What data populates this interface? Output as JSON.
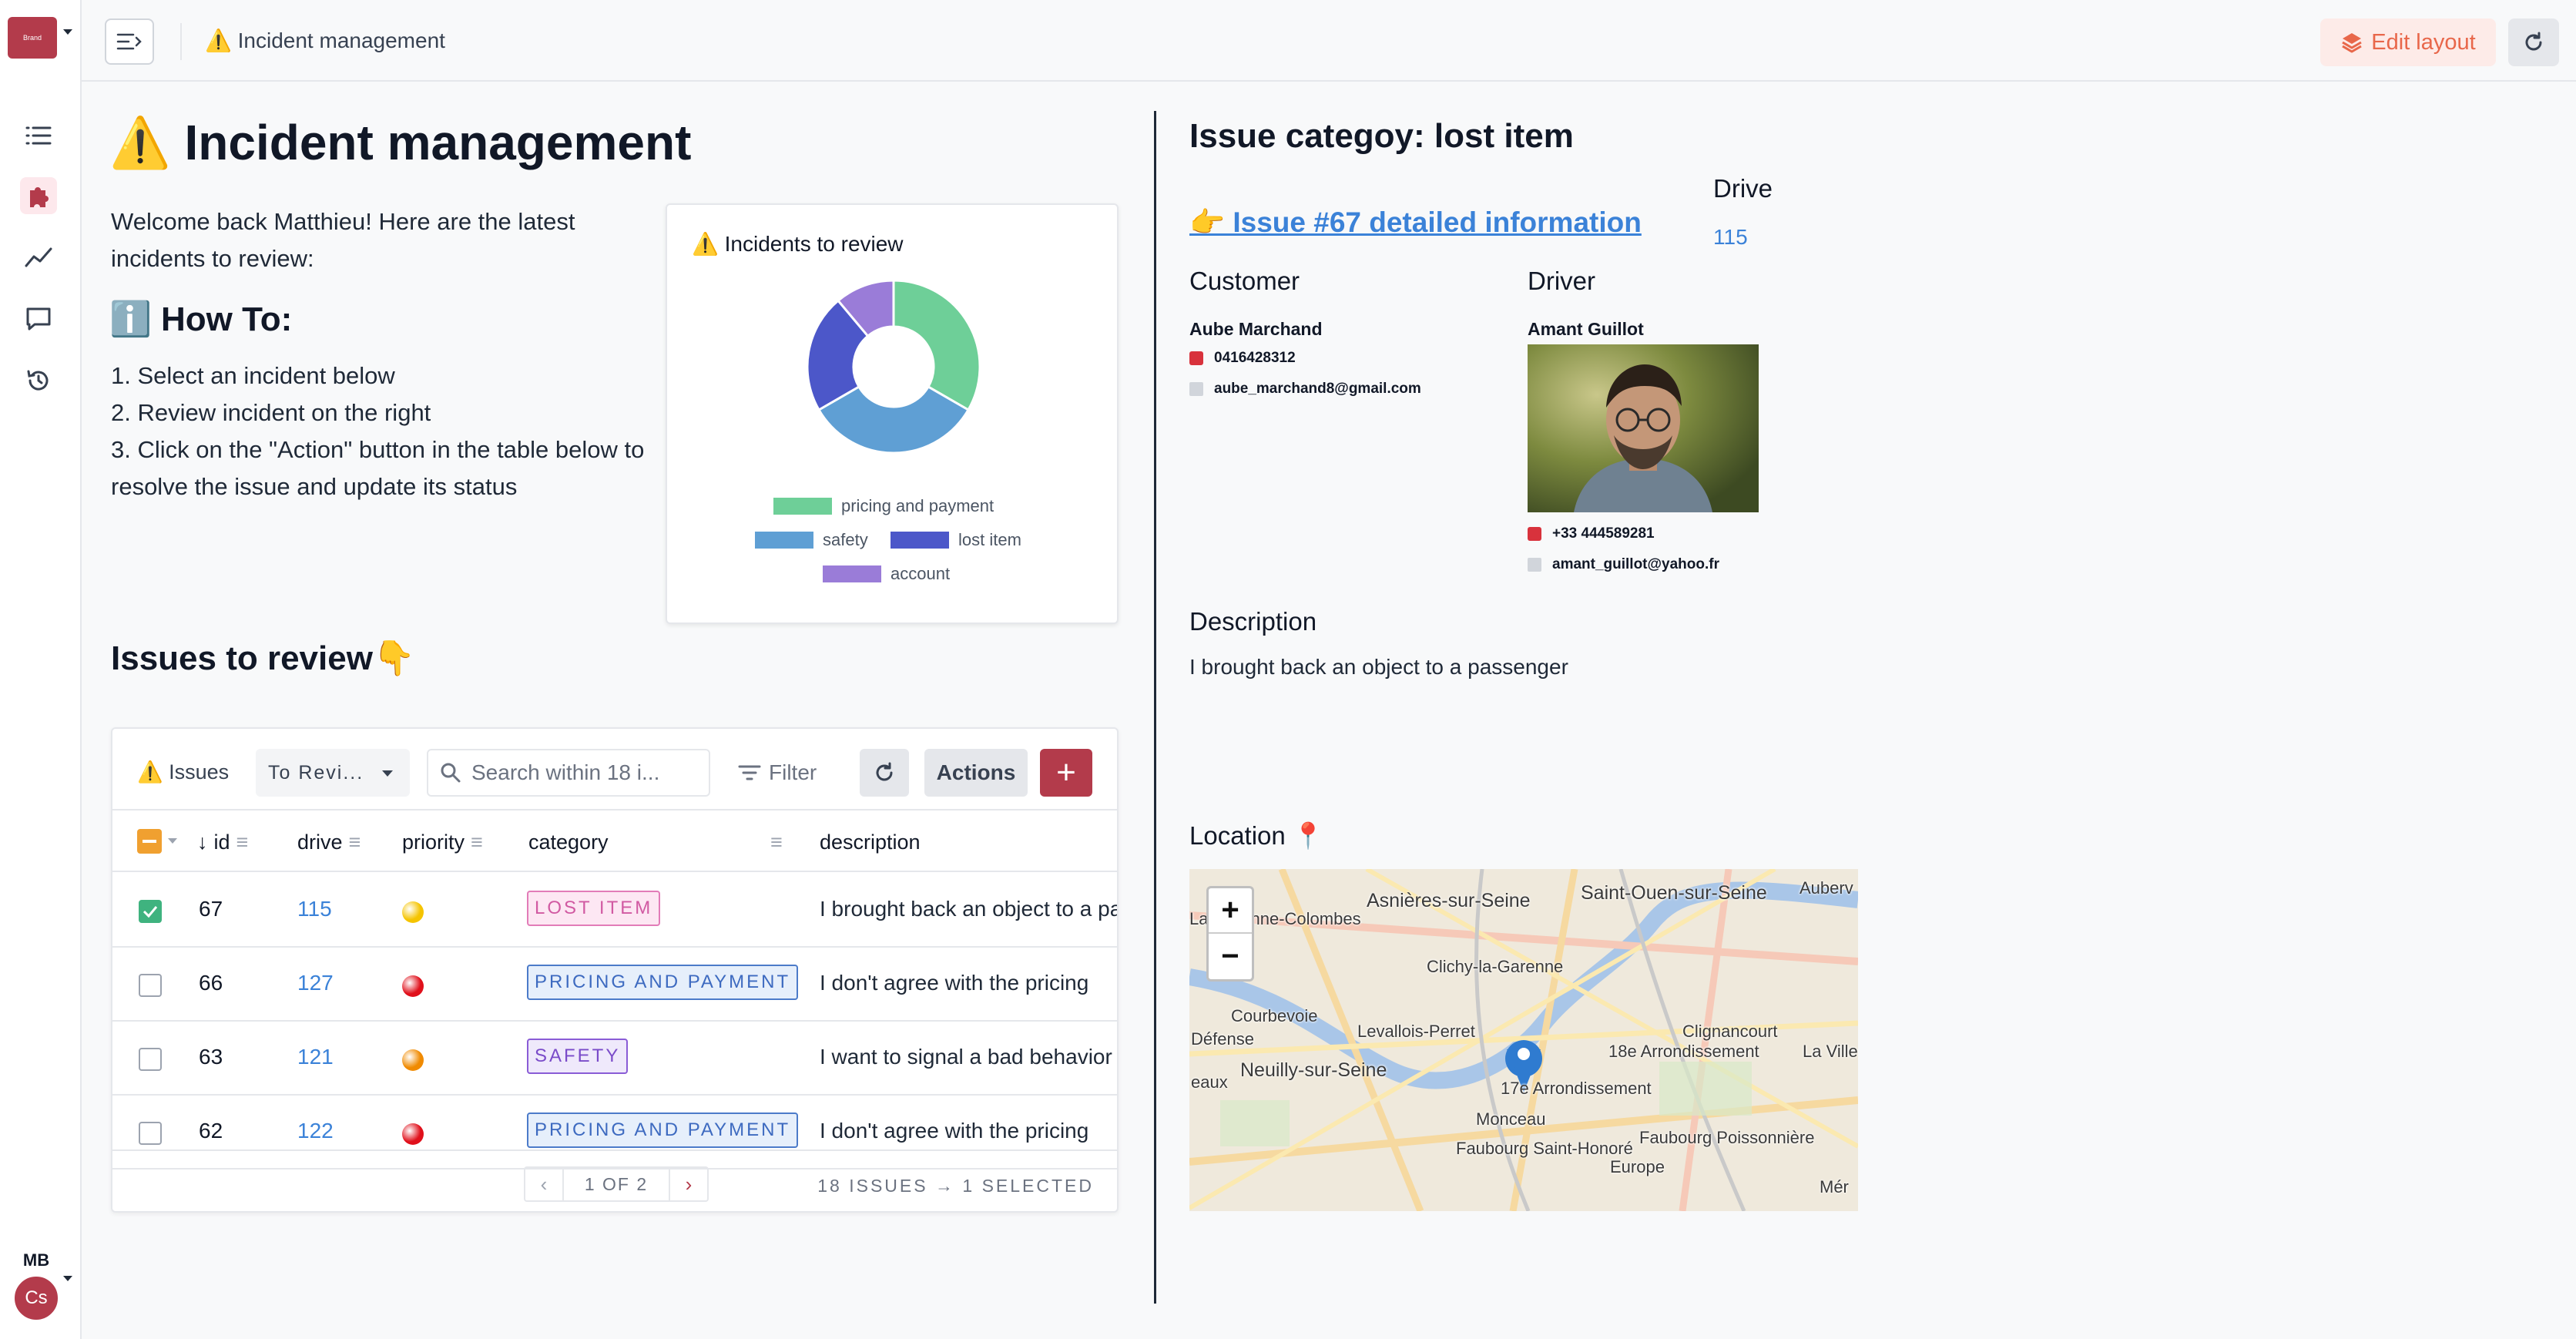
{
  "app": {
    "logo_text": "Brand"
  },
  "header": {
    "title": "⚠️ Incident management",
    "edit_layout": "Edit layout"
  },
  "rail": {
    "avatar_initials": "MB",
    "workspace_initials": "Cs"
  },
  "left": {
    "heading": "⚠️ Incident management",
    "welcome": "Welcome back Matthieu! Here are the latest incidents to review:",
    "howto_title": "ℹ️ How To:",
    "steps": [
      "1. Select an incident below",
      "2. Review incident on the right",
      "3. Click on the \"Action\" button in the table below to resolve the issue and update its status"
    ],
    "issues_heading": "Issues to review👇"
  },
  "chart_card": {
    "title": "⚠️ Incidents to review"
  },
  "chart_data": {
    "type": "pie",
    "title": "⚠️ Incidents to review",
    "categories": [
      "pricing and payment",
      "safety",
      "lost item",
      "account"
    ],
    "values": [
      6,
      6,
      4,
      2
    ],
    "colors": [
      "#6ecf98",
      "#5f9fd4",
      "#4c57c9",
      "#9a7cd8"
    ],
    "donut": true,
    "legend_position": "bottom"
  },
  "table": {
    "label": "⚠️ Issues",
    "view_select": "To Revi...",
    "search_placeholder": "Search within 18 i...",
    "filter_label": "Filter",
    "actions_label": "Actions",
    "add_label": "+",
    "columns": [
      "id",
      "drive",
      "priority",
      "category",
      "description"
    ],
    "rows": [
      {
        "id": "67",
        "drive": "115",
        "priority_color": "#f5c400",
        "category": "LOST ITEM",
        "tag_bg": "#fde7f3",
        "tag_border": "#e27cb8",
        "tag_color": "#d15aa2",
        "description": "I brought back an object to a passenger",
        "selected": true
      },
      {
        "id": "66",
        "drive": "127",
        "priority_color": "#e0101b",
        "category": "PRICING AND PAYMENT",
        "tag_bg": "#e6effb",
        "tag_border": "#4c7bc9",
        "tag_color": "#3d6ac0",
        "description": "I don't agree with the pricing",
        "selected": false
      },
      {
        "id": "63",
        "drive": "121",
        "priority_color": "#f08a00",
        "category": "SAFETY",
        "tag_bg": "#efe9fb",
        "tag_border": "#8a5cd6",
        "tag_color": "#7a4bc9",
        "description": "I want to signal a bad behavior",
        "selected": false
      },
      {
        "id": "62",
        "drive": "122",
        "priority_color": "#e0101b",
        "category": "PRICING AND PAYMENT",
        "tag_bg": "#e6effb",
        "tag_border": "#4c7bc9",
        "tag_color": "#3d6ac0",
        "description": "I don't agree with the pricing",
        "selected": false
      }
    ],
    "pager_text": "1 OF 2",
    "count_text": "18 ISSUES → 1 SELECTED"
  },
  "detail": {
    "heading": "Issue categoy: lost item",
    "link": "👉 Issue #67 detailed information",
    "drive_label": "Drive",
    "drive_value": "115",
    "customer_label": "Customer",
    "customer_name": "Aube Marchand",
    "customer_phone": "0416428312",
    "customer_email": "aube_marchand8@gmail.com",
    "driver_label": "Driver",
    "driver_name": "Amant Guillot",
    "driver_phone": "+33 444589281",
    "driver_email": "amant_guillot@yahoo.fr",
    "description_label": "Description",
    "description": "I brought back an object to a passenger",
    "location_label": "Location 📍",
    "map_labels": [
      "Asnières-sur-Seine",
      "Saint-Ouen-sur-Seine",
      "Auberv",
      "Clichy-la-Garenne",
      "Courbevoie",
      "Levallois-Perret",
      "Clignancourt",
      "18e Arrondissement",
      "La Ville",
      "Neuilly-sur-Seine",
      "17e Arrondissement",
      "Monceau",
      "Faubourg Saint-Honoré",
      "Faubourg Poissonnière",
      "Europe",
      "Défense",
      "eaux",
      "Mér",
      "La Garenne-Colombes"
    ],
    "zoom_in": "+",
    "zoom_out": "−"
  }
}
